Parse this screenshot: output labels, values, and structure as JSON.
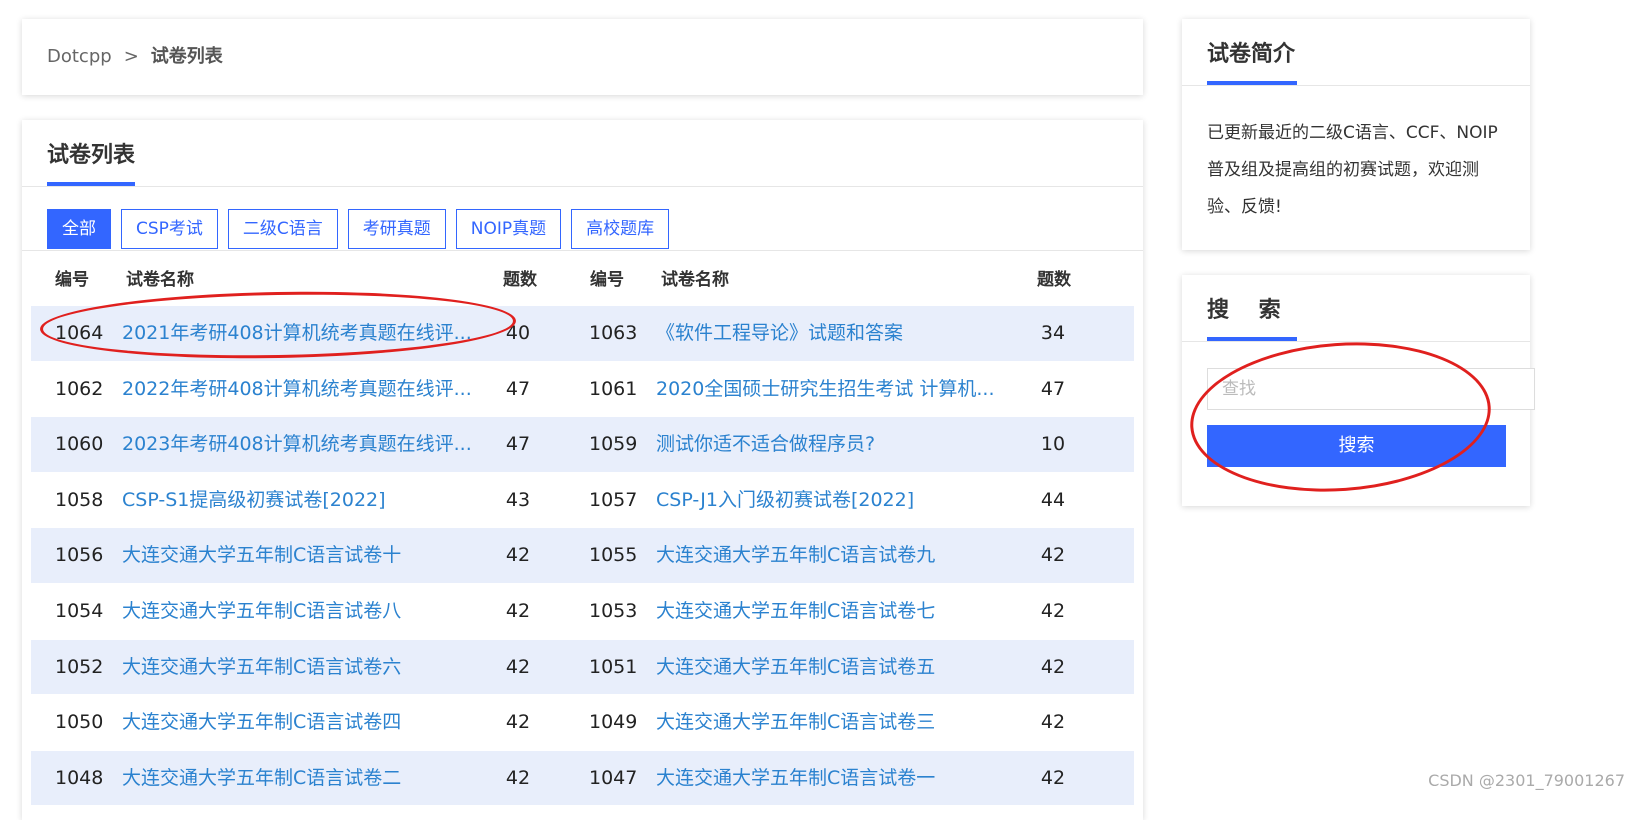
{
  "breadcrumb": {
    "home": "Dotcpp",
    "separator": ">",
    "current": "试卷列表"
  },
  "list": {
    "title": "试卷列表",
    "tabs": [
      {
        "label": "全部",
        "active": true
      },
      {
        "label": "CSP考试",
        "active": false
      },
      {
        "label": "二级C语言",
        "active": false
      },
      {
        "label": "考研真题",
        "active": false
      },
      {
        "label": "NOIP真题",
        "active": false
      },
      {
        "label": "高校题库",
        "active": false
      }
    ],
    "headers": {
      "id": "编号",
      "name": "试卷名称",
      "count": "题数"
    },
    "rows": [
      {
        "left": {
          "id": "1064",
          "name": "2021年考研408计算机统考真题在线评...",
          "count": "40"
        },
        "right": {
          "id": "1063",
          "name": "《软件工程导论》试题和答案",
          "count": "34"
        }
      },
      {
        "left": {
          "id": "1062",
          "name": "2022年考研408计算机统考真题在线评...",
          "count": "47"
        },
        "right": {
          "id": "1061",
          "name": "2020全国硕士研究生招生考试 计算机...",
          "count": "47"
        }
      },
      {
        "left": {
          "id": "1060",
          "name": "2023年考研408计算机统考真题在线评...",
          "count": "47"
        },
        "right": {
          "id": "1059",
          "name": "测试你适不适合做程序员?",
          "count": "10"
        }
      },
      {
        "left": {
          "id": "1058",
          "name": "CSP-S1提高级初赛试卷[2022]",
          "count": "43"
        },
        "right": {
          "id": "1057",
          "name": "CSP-J1入门级初赛试卷[2022]",
          "count": "44"
        }
      },
      {
        "left": {
          "id": "1056",
          "name": "大连交通大学五年制C语言试卷十",
          "count": "42"
        },
        "right": {
          "id": "1055",
          "name": "大连交通大学五年制C语言试卷九",
          "count": "42"
        }
      },
      {
        "left": {
          "id": "1054",
          "name": "大连交通大学五年制C语言试卷八",
          "count": "42"
        },
        "right": {
          "id": "1053",
          "name": "大连交通大学五年制C语言试卷七",
          "count": "42"
        }
      },
      {
        "left": {
          "id": "1052",
          "name": "大连交通大学五年制C语言试卷六",
          "count": "42"
        },
        "right": {
          "id": "1051",
          "name": "大连交通大学五年制C语言试卷五",
          "count": "42"
        }
      },
      {
        "left": {
          "id": "1050",
          "name": "大连交通大学五年制C语言试卷四",
          "count": "42"
        },
        "right": {
          "id": "1049",
          "name": "大连交通大学五年制C语言试卷三",
          "count": "42"
        }
      },
      {
        "left": {
          "id": "1048",
          "name": "大连交通大学五年制C语言试卷二",
          "count": "42"
        },
        "right": {
          "id": "1047",
          "name": "大连交通大学五年制C语言试卷一",
          "count": "42"
        }
      }
    ]
  },
  "intro": {
    "title": "试卷简介",
    "text": "已更新最近的二级C语言、CCF、NOIP普及组及提高组的初赛试题，欢迎测验、反馈!"
  },
  "search": {
    "title": "搜　 索",
    "placeholder": "查找",
    "value": "",
    "button": "搜索"
  },
  "watermark": "CSDN @2301_79001267",
  "colors": {
    "accent": "#3366ff",
    "link": "#2b82cf",
    "stripe": "#e8eefb",
    "annotation": "#e0201e"
  }
}
